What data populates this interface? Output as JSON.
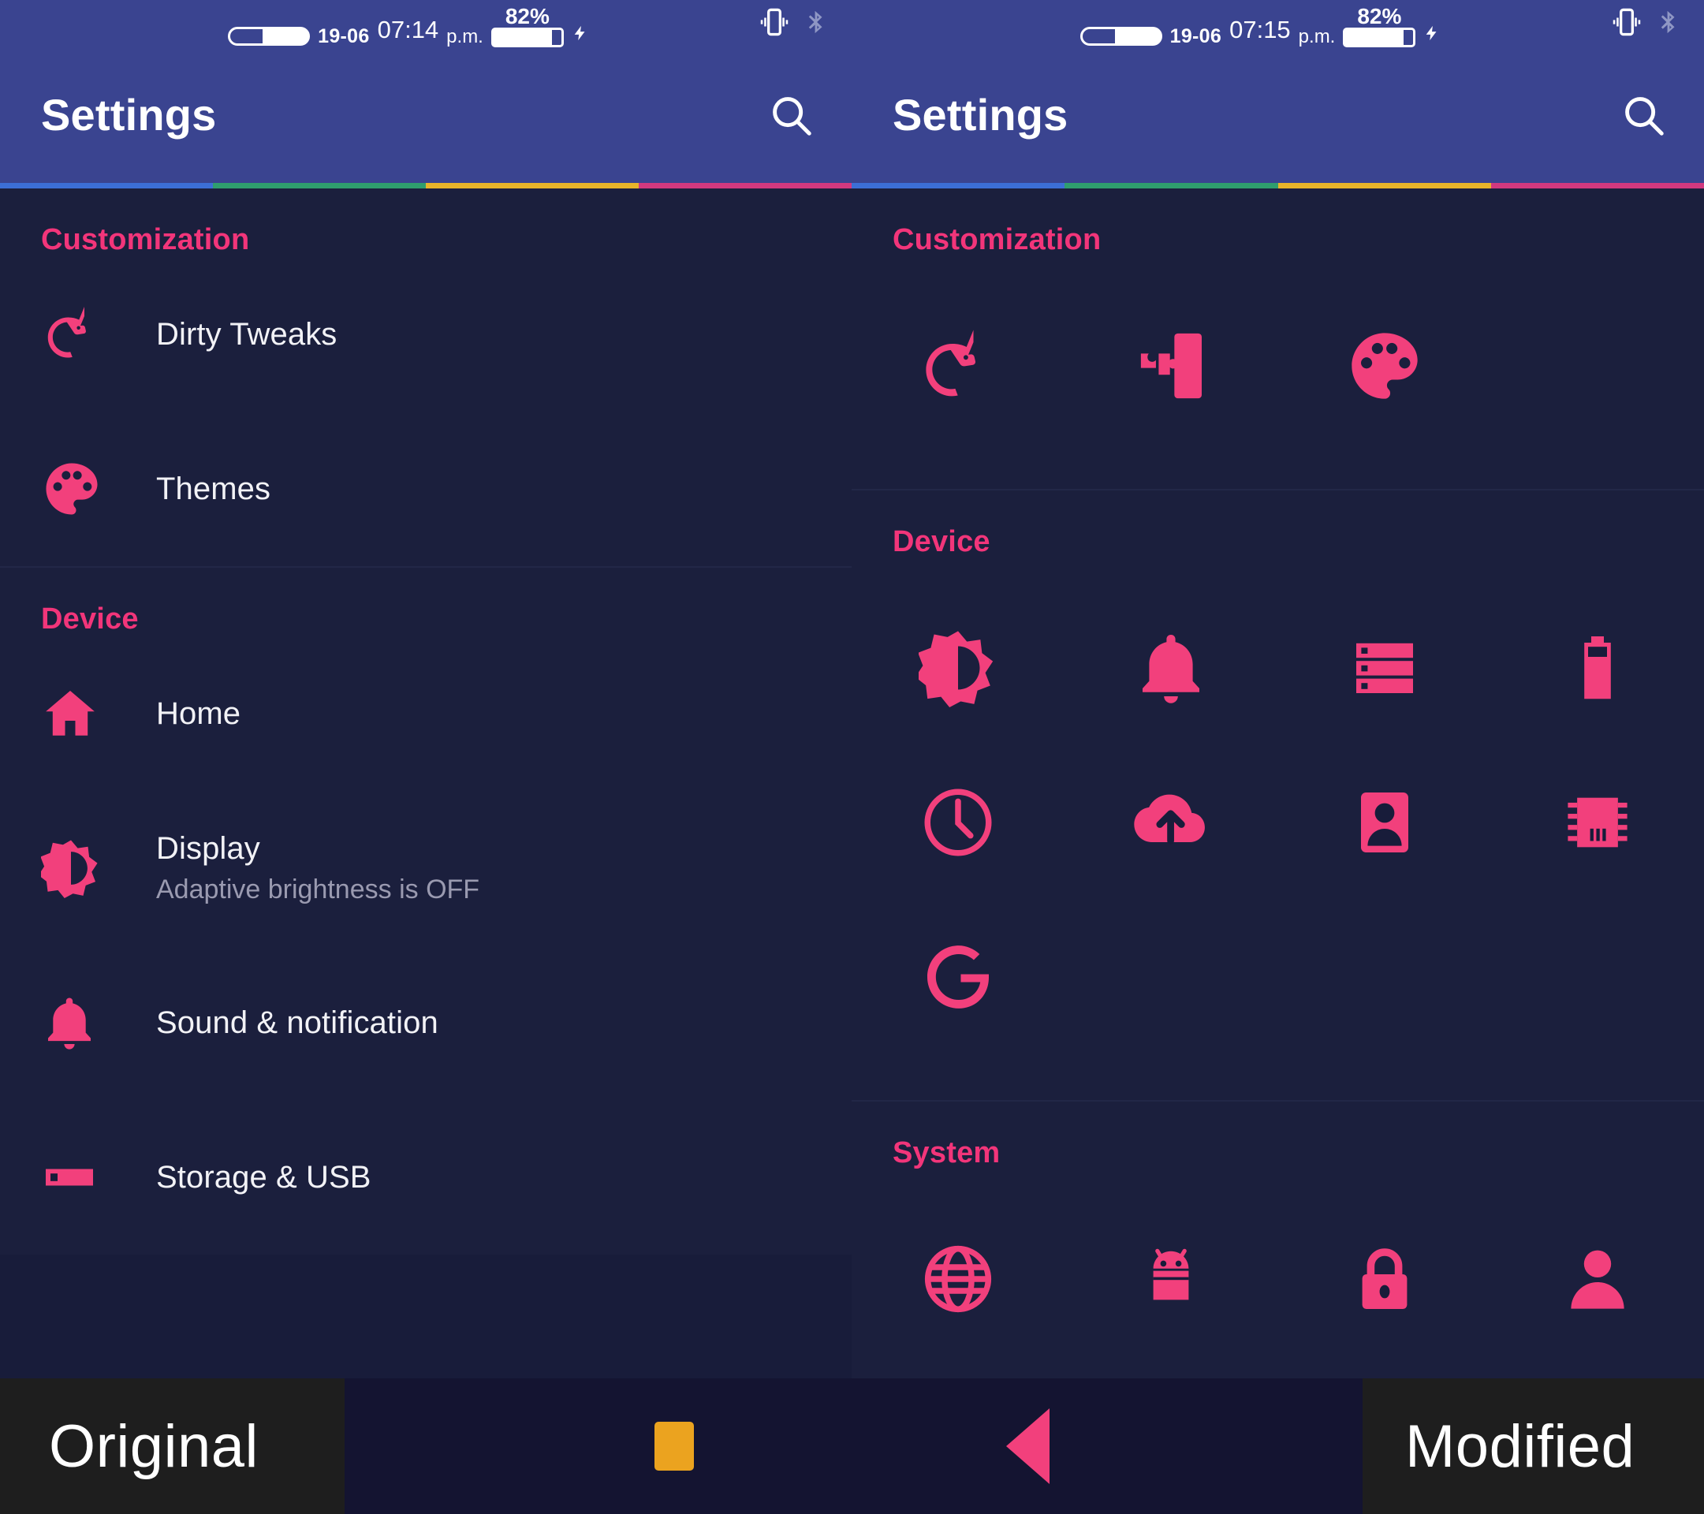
{
  "accent": {
    "pink": "#f2407c",
    "header_blue": "#3a4490",
    "bg_dark": "#181c3a",
    "card": "#1b1f3d",
    "orange": "#eba31f",
    "strip": [
      "#3c6fd6",
      "#2f9e6e",
      "#e8b42a",
      "#d1397f"
    ]
  },
  "left_panel": {
    "status": {
      "date": "19-06",
      "time": "07:14",
      "ampm": "p.m.",
      "battery_pct": "82%",
      "charging_icon": "bolt-icon",
      "vibrate_icon": "vibrate-icon",
      "bluetooth_icon": "bluetooth-icon",
      "pill_icon": "progress-pill-icon"
    },
    "appbar": {
      "title": "Settings",
      "search_icon": "search-icon"
    },
    "sections": [
      {
        "title": "Customization",
        "items": [
          {
            "label": "Dirty Tweaks",
            "sub": "",
            "icon": "unicorn-icon"
          },
          {
            "label": "Themes",
            "sub": "",
            "icon": "palette-icon"
          }
        ]
      },
      {
        "title": "Device",
        "items": [
          {
            "label": "Home",
            "sub": "",
            "icon": "home-icon"
          },
          {
            "label": "Display",
            "sub": "Adaptive brightness is OFF",
            "icon": "brightness-icon"
          },
          {
            "label": "Sound & notification",
            "sub": "",
            "icon": "bell-icon"
          },
          {
            "label": "Storage & USB",
            "sub": "",
            "icon": "storage-icon"
          }
        ]
      }
    ]
  },
  "right_panel": {
    "status": {
      "date": "19-06",
      "time": "07:15",
      "ampm": "p.m.",
      "battery_pct": "82%",
      "charging_icon": "bolt-icon",
      "vibrate_icon": "vibrate-icon",
      "bluetooth_icon": "bluetooth-icon",
      "pill_icon": "progress-pill-icon"
    },
    "appbar": {
      "title": "Settings",
      "search_icon": "search-icon"
    },
    "sections": [
      {
        "title": "Customization",
        "icons": [
          "unicorn-icon",
          "puzzle-icon",
          "palette-icon"
        ]
      },
      {
        "title": "Device",
        "icons": [
          "brightness-icon",
          "bell-icon",
          "storage-list-icon",
          "battery-icon",
          "clock-icon",
          "cloud-upload-icon",
          "contact-card-icon",
          "chip-icon",
          "google-g-icon"
        ]
      },
      {
        "title": "System",
        "icons": [
          "globe-icon",
          "android-icon",
          "lock-icon",
          "user-icon"
        ]
      }
    ]
  },
  "navbar": {
    "left_label": "Original",
    "right_label": "Modified",
    "recents_button": "recents-square-button",
    "back_button": "back-triangle-button"
  }
}
